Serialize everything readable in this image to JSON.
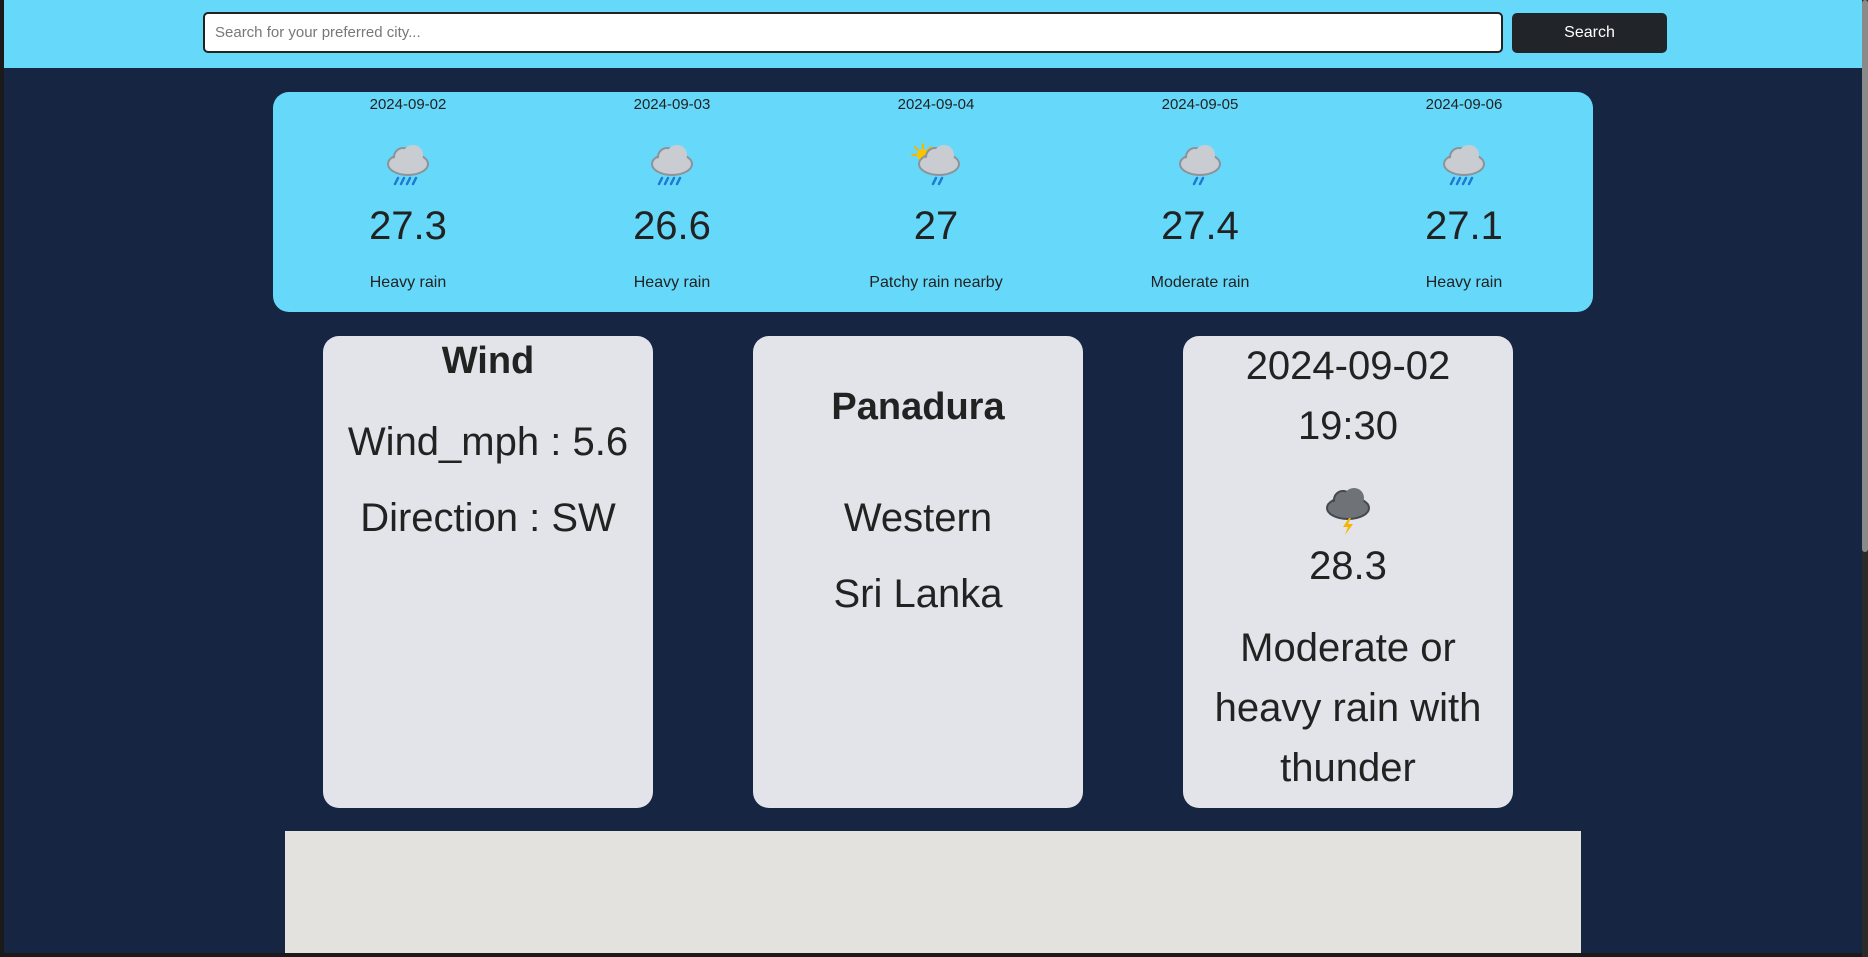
{
  "search": {
    "placeholder": "Search for your preferred city...",
    "value": "",
    "button_label": "Search"
  },
  "forecast": [
    {
      "date": "2024-09-02",
      "temp": "27.3",
      "condition": "Heavy rain",
      "icon": "heavy-rain-icon"
    },
    {
      "date": "2024-09-03",
      "temp": "26.6",
      "condition": "Heavy rain",
      "icon": "heavy-rain-icon"
    },
    {
      "date": "2024-09-04",
      "temp": "27",
      "condition": "Patchy rain nearby",
      "icon": "patchy-rain-icon"
    },
    {
      "date": "2024-09-05",
      "temp": "27.4",
      "condition": "Moderate rain",
      "icon": "moderate-rain-icon"
    },
    {
      "date": "2024-09-06",
      "temp": "27.1",
      "condition": "Heavy rain",
      "icon": "heavy-rain-icon"
    }
  ],
  "wind": {
    "title": "Wind",
    "mph_line": "Wind_mph : 5.6",
    "direction_line": "Direction : SW"
  },
  "location": {
    "city": "Panadura",
    "region": "Western",
    "country": "Sri Lanka"
  },
  "current": {
    "date": "2024-09-02",
    "time": "19:30",
    "icon": "thunder-rain-icon",
    "temp": "28.3",
    "condition": "Moderate or heavy rain with thunder"
  },
  "colors": {
    "background": "#162642",
    "accent": "#66d9fb",
    "card": "#e2e4e9",
    "button": "#212529",
    "map": "#e3e2de"
  }
}
